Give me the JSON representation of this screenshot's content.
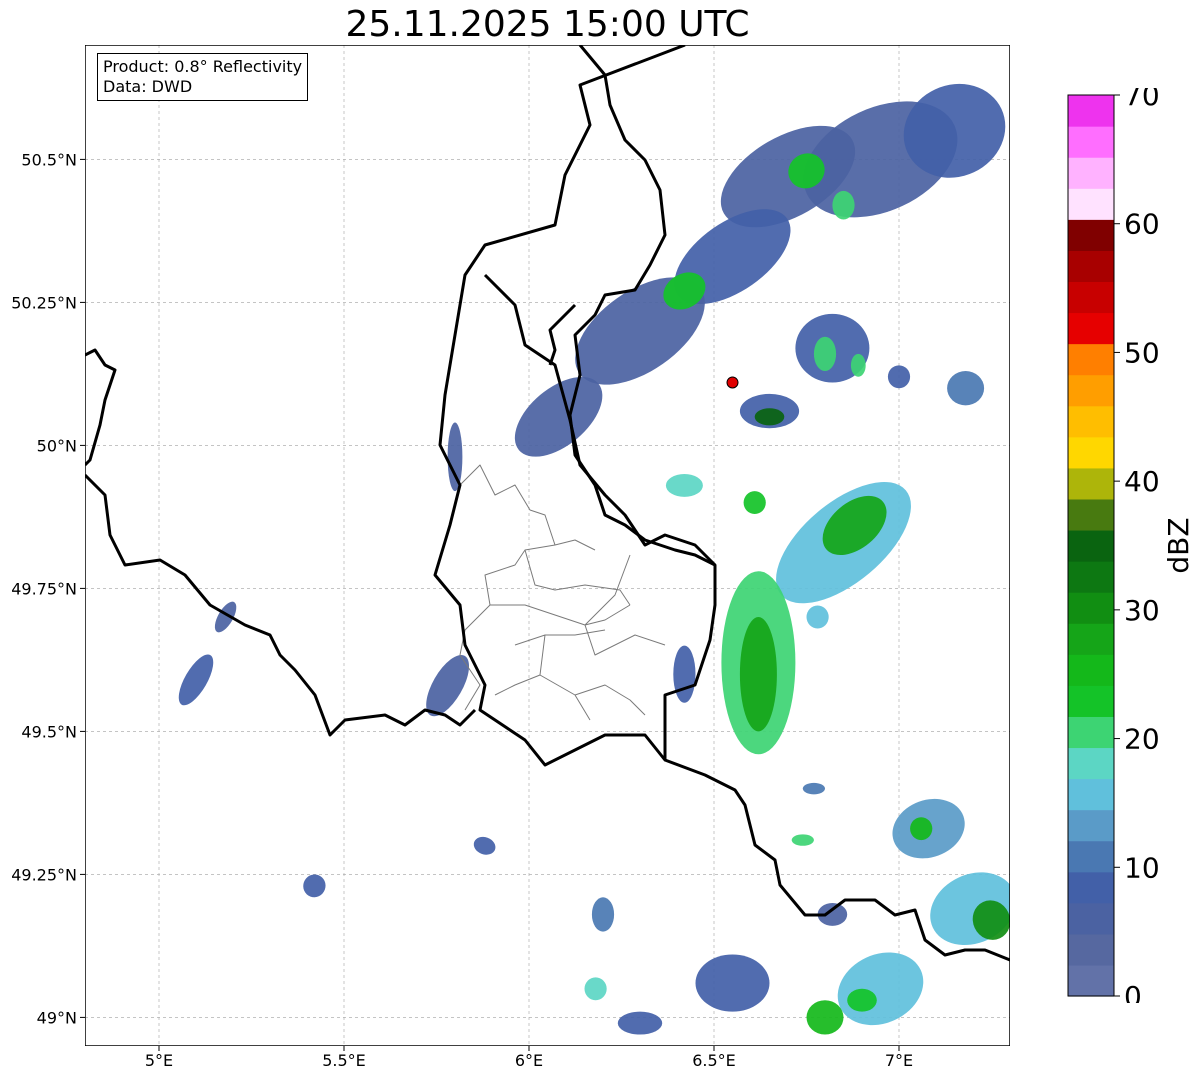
{
  "title": "25.11.2025 15:00 UTC",
  "info_box": {
    "product": "Product: 0.8° Reflectivity",
    "data": "Data: DWD"
  },
  "map": {
    "lon_range": [
      4.8,
      7.3
    ],
    "lat_range": [
      48.95,
      50.7
    ],
    "lon_ticks": [
      {
        "value": 5.0,
        "label": "5°E"
      },
      {
        "value": 5.5,
        "label": "5.5°E"
      },
      {
        "value": 6.0,
        "label": "6°E"
      },
      {
        "value": 6.5,
        "label": "6.5°E"
      },
      {
        "value": 7.0,
        "label": "7°E"
      }
    ],
    "lat_ticks": [
      {
        "value": 49.0,
        "label": "49°N"
      },
      {
        "value": 49.25,
        "label": "49.25°N"
      },
      {
        "value": 49.5,
        "label": "49.5°N"
      },
      {
        "value": 49.75,
        "label": "49.75°N"
      },
      {
        "value": 50.0,
        "label": "50°N"
      },
      {
        "value": 50.25,
        "label": "50.25°N"
      },
      {
        "value": 50.5,
        "label": "50.5°N"
      }
    ],
    "grid": true,
    "radar_site": {
      "lon": 6.55,
      "lat": 50.11,
      "color": "#e00000"
    },
    "echoes": [
      {
        "lon": 6.7,
        "lat": 50.47,
        "rx": 0.2,
        "ry": 0.07,
        "rot": -30,
        "dbz": 7
      },
      {
        "lon": 6.95,
        "lat": 50.5,
        "rx": 0.22,
        "ry": 0.09,
        "rot": -25,
        "dbz": 6
      },
      {
        "lon": 7.15,
        "lat": 50.55,
        "rx": 0.14,
        "ry": 0.08,
        "rot": -25,
        "dbz": 9
      },
      {
        "lon": 6.55,
        "lat": 50.33,
        "rx": 0.18,
        "ry": 0.06,
        "rot": -35,
        "dbz": 8
      },
      {
        "lon": 6.3,
        "lat": 50.2,
        "rx": 0.2,
        "ry": 0.07,
        "rot": -35,
        "dbz": 7
      },
      {
        "lon": 6.08,
        "lat": 50.05,
        "rx": 0.14,
        "ry": 0.05,
        "rot": -40,
        "dbz": 6
      },
      {
        "lon": 6.42,
        "lat": 50.27,
        "rx": 0.06,
        "ry": 0.03,
        "rot": -30,
        "dbz": 22
      },
      {
        "lon": 6.75,
        "lat": 50.48,
        "rx": 0.05,
        "ry": 0.03,
        "rot": -30,
        "dbz": 22
      },
      {
        "lon": 6.85,
        "lat": 50.42,
        "rx": 0.03,
        "ry": 0.025,
        "rot": 0,
        "dbz": 20
      },
      {
        "lon": 6.82,
        "lat": 50.17,
        "rx": 0.1,
        "ry": 0.06,
        "rot": 0,
        "dbz": 8
      },
      {
        "lon": 6.8,
        "lat": 50.16,
        "rx": 0.03,
        "ry": 0.03,
        "rot": 0,
        "dbz": 20
      },
      {
        "lon": 6.89,
        "lat": 50.14,
        "rx": 0.02,
        "ry": 0.02,
        "rot": 0,
        "dbz": 21
      },
      {
        "lon": 6.65,
        "lat": 50.06,
        "rx": 0.08,
        "ry": 0.03,
        "rot": 0,
        "dbz": 8
      },
      {
        "lon": 6.65,
        "lat": 50.05,
        "rx": 0.04,
        "ry": 0.015,
        "rot": 0,
        "dbz": 35
      },
      {
        "lon": 7.0,
        "lat": 50.12,
        "rx": 0.03,
        "ry": 0.02,
        "rot": 0,
        "dbz": 8
      },
      {
        "lon": 7.18,
        "lat": 50.1,
        "rx": 0.05,
        "ry": 0.03,
        "rot": 0,
        "dbz": 10
      },
      {
        "lon": 6.42,
        "lat": 49.93,
        "rx": 0.05,
        "ry": 0.02,
        "rot": 0,
        "dbz": 17
      },
      {
        "lon": 6.61,
        "lat": 49.9,
        "rx": 0.03,
        "ry": 0.02,
        "rot": 0,
        "dbz": 24
      },
      {
        "lon": 6.85,
        "lat": 49.83,
        "rx": 0.22,
        "ry": 0.07,
        "rot": -40,
        "dbz": 15
      },
      {
        "lon": 6.88,
        "lat": 49.86,
        "rx": 0.1,
        "ry": 0.04,
        "rot": -40,
        "dbz": 28
      },
      {
        "lon": 6.62,
        "lat": 49.62,
        "rx": 0.1,
        "ry": 0.16,
        "rot": 0,
        "dbz": 20
      },
      {
        "lon": 6.62,
        "lat": 49.6,
        "rx": 0.05,
        "ry": 0.1,
        "rot": 0,
        "dbz": 27
      },
      {
        "lon": 6.42,
        "lat": 49.6,
        "rx": 0.03,
        "ry": 0.05,
        "rot": 0,
        "dbz": 8
      },
      {
        "lon": 5.78,
        "lat": 49.58,
        "rx": 0.04,
        "ry": 0.06,
        "rot": 30,
        "dbz": 6
      },
      {
        "lon": 5.1,
        "lat": 49.59,
        "rx": 0.03,
        "ry": 0.05,
        "rot": 30,
        "dbz": 9
      },
      {
        "lon": 5.18,
        "lat": 49.7,
        "rx": 0.02,
        "ry": 0.03,
        "rot": 30,
        "dbz": 7
      },
      {
        "lon": 5.8,
        "lat": 49.98,
        "rx": 0.02,
        "ry": 0.06,
        "rot": 0,
        "dbz": 6
      },
      {
        "lon": 5.88,
        "lat": 49.3,
        "rx": 0.03,
        "ry": 0.015,
        "rot": 20,
        "dbz": 8
      },
      {
        "lon": 5.42,
        "lat": 49.23,
        "rx": 0.03,
        "ry": 0.02,
        "rot": 20,
        "dbz": 8
      },
      {
        "lon": 7.08,
        "lat": 49.33,
        "rx": 0.1,
        "ry": 0.05,
        "rot": -20,
        "dbz": 14
      },
      {
        "lon": 7.06,
        "lat": 49.33,
        "rx": 0.03,
        "ry": 0.02,
        "rot": 0,
        "dbz": 26
      },
      {
        "lon": 7.2,
        "lat": 49.19,
        "rx": 0.12,
        "ry": 0.06,
        "rot": -25,
        "dbz": 15
      },
      {
        "lon": 7.25,
        "lat": 49.17,
        "rx": 0.05,
        "ry": 0.035,
        "rot": -25,
        "dbz": 29
      },
      {
        "lon": 6.95,
        "lat": 49.05,
        "rx": 0.12,
        "ry": 0.06,
        "rot": -25,
        "dbz": 16
      },
      {
        "lon": 6.9,
        "lat": 49.03,
        "rx": 0.04,
        "ry": 0.02,
        "rot": 0,
        "dbz": 24
      },
      {
        "lon": 6.8,
        "lat": 49.0,
        "rx": 0.05,
        "ry": 0.03,
        "rot": 0,
        "dbz": 26
      },
      {
        "lon": 6.55,
        "lat": 49.06,
        "rx": 0.1,
        "ry": 0.05,
        "rot": 0,
        "dbz": 9
      },
      {
        "lon": 6.2,
        "lat": 49.18,
        "rx": 0.03,
        "ry": 0.03,
        "rot": 0,
        "dbz": 11
      },
      {
        "lon": 6.18,
        "lat": 49.05,
        "rx": 0.03,
        "ry": 0.02,
        "rot": 0,
        "dbz": 17
      },
      {
        "lon": 6.3,
        "lat": 48.99,
        "rx": 0.06,
        "ry": 0.02,
        "rot": 0,
        "dbz": 8
      },
      {
        "lon": 6.74,
        "lat": 49.31,
        "rx": 0.03,
        "ry": 0.01,
        "rot": 0,
        "dbz": 21
      },
      {
        "lon": 6.77,
        "lat": 49.4,
        "rx": 0.03,
        "ry": 0.01,
        "rot": 0,
        "dbz": 12
      },
      {
        "lon": 6.82,
        "lat": 49.18,
        "rx": 0.04,
        "ry": 0.02,
        "rot": 0,
        "dbz": 7
      },
      {
        "lon": 6.78,
        "lat": 49.7,
        "rx": 0.03,
        "ry": 0.02,
        "rot": 0,
        "dbz": 16
      }
    ]
  },
  "colorbar": {
    "label": "dBZ",
    "ticks": [
      0,
      10,
      20,
      30,
      40,
      50,
      60,
      70
    ],
    "colors": [
      "#6272a8",
      "#5668a0",
      "#4b62a2",
      "#4260a8",
      "#4a78b2",
      "#5a9bc8",
      "#60c0dc",
      "#5cd6c4",
      "#3dd473",
      "#14c328",
      "#14b81a",
      "#15a518",
      "#118e12",
      "#0d7812",
      "#0a6410",
      "#487a10",
      "#adb50a",
      "#ffd700",
      "#ffbe00",
      "#ff9e00",
      "#ff7f00",
      "#e60000",
      "#c80000",
      "#a80000",
      "#800000",
      "#ffe2ff",
      "#ffb2ff",
      "#ff6eff",
      "#ee33ee"
    ]
  }
}
